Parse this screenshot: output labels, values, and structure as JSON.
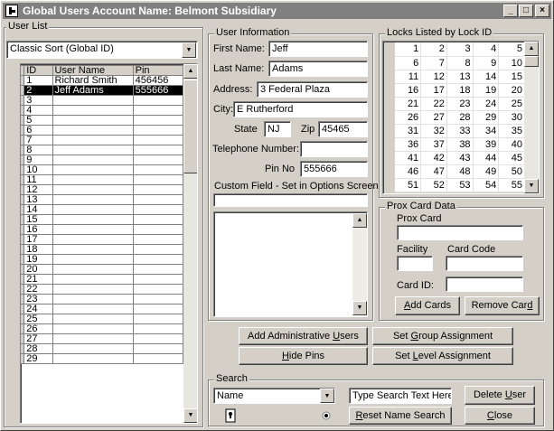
{
  "window": {
    "title": "Global Users Account Name: Belmont Subsidiary",
    "min_label": "_",
    "max_label": "□",
    "close_label": "×"
  },
  "user_list": {
    "group_title": "User List",
    "sort_value": "Classic Sort (Global ID)",
    "columns": [
      "ID",
      "User Name",
      "Pin"
    ],
    "rows": [
      {
        "id": "1",
        "name": "Richard Smith",
        "pin": "456456",
        "selected": false
      },
      {
        "id": "2",
        "name": "Jeff Adams",
        "pin": "555666",
        "selected": true
      },
      {
        "id": "3",
        "name": "",
        "pin": ""
      },
      {
        "id": "4",
        "name": "",
        "pin": ""
      },
      {
        "id": "5",
        "name": "",
        "pin": ""
      },
      {
        "id": "6",
        "name": "",
        "pin": ""
      },
      {
        "id": "7",
        "name": "",
        "pin": ""
      },
      {
        "id": "8",
        "name": "",
        "pin": ""
      },
      {
        "id": "9",
        "name": "",
        "pin": ""
      },
      {
        "id": "10",
        "name": "",
        "pin": ""
      },
      {
        "id": "11",
        "name": "",
        "pin": ""
      },
      {
        "id": "12",
        "name": "",
        "pin": ""
      },
      {
        "id": "13",
        "name": "",
        "pin": ""
      },
      {
        "id": "14",
        "name": "",
        "pin": ""
      },
      {
        "id": "15",
        "name": "",
        "pin": ""
      },
      {
        "id": "16",
        "name": "",
        "pin": ""
      },
      {
        "id": "17",
        "name": "",
        "pin": ""
      },
      {
        "id": "18",
        "name": "",
        "pin": ""
      },
      {
        "id": "19",
        "name": "",
        "pin": ""
      },
      {
        "id": "20",
        "name": "",
        "pin": ""
      },
      {
        "id": "21",
        "name": "",
        "pin": ""
      },
      {
        "id": "22",
        "name": "",
        "pin": ""
      },
      {
        "id": "23",
        "name": "",
        "pin": ""
      },
      {
        "id": "24",
        "name": "",
        "pin": ""
      },
      {
        "id": "25",
        "name": "",
        "pin": ""
      },
      {
        "id": "26",
        "name": "",
        "pin": ""
      },
      {
        "id": "27",
        "name": "",
        "pin": ""
      },
      {
        "id": "28",
        "name": "",
        "pin": ""
      },
      {
        "id": "29",
        "name": "",
        "pin": ""
      }
    ]
  },
  "user_info": {
    "group_title": "User Information",
    "first_name_label": "First Name:",
    "first_name": "Jeff",
    "last_name_label": "Last Name:",
    "last_name": "Adams",
    "address_label": "Address:",
    "address": "3 Federal Plaza",
    "city_label": "City:",
    "city": "E Rutherford",
    "state_label": "State",
    "state": "NJ",
    "zip_label": "Zip",
    "zip": "45465",
    "phone_label": "Telephone Number:",
    "phone": "",
    "pin_label": "Pin No",
    "pin": "555666",
    "custom_label": "Custom Field - Set in Options Screen",
    "custom_value": "",
    "notes": ""
  },
  "locks": {
    "group_title": "Locks Listed by Lock ID",
    "rows": [
      [
        "1",
        "2",
        "3",
        "4",
        "5"
      ],
      [
        "6",
        "7",
        "8",
        "9",
        "10"
      ],
      [
        "11",
        "12",
        "13",
        "14",
        "15"
      ],
      [
        "16",
        "17",
        "18",
        "19",
        "20"
      ],
      [
        "21",
        "22",
        "23",
        "24",
        "25"
      ],
      [
        "26",
        "27",
        "28",
        "29",
        "30"
      ],
      [
        "31",
        "32",
        "33",
        "34",
        "35"
      ],
      [
        "36",
        "37",
        "38",
        "39",
        "40"
      ],
      [
        "41",
        "42",
        "43",
        "44",
        "45"
      ],
      [
        "46",
        "47",
        "48",
        "49",
        "50"
      ],
      [
        "51",
        "52",
        "53",
        "54",
        "55"
      ]
    ]
  },
  "prox": {
    "group_title": "Prox Card Data",
    "prox_card_label": "Prox Card",
    "prox_card": "",
    "facility_label": "Facility",
    "facility": "",
    "card_code_label": "Card Code",
    "card_code": "",
    "card_id_label": "Card ID:",
    "card_id": "",
    "add_cards_pre": "",
    "add_cards_u": "A",
    "add_cards_post": "dd Cards",
    "remove_card_pre": "Remove Car",
    "remove_card_u": "d",
    "remove_card_post": ""
  },
  "actions": {
    "add_admin_pre": "Add Administrative ",
    "add_admin_u": "U",
    "add_admin_post": "sers",
    "hide_pins_pre": "",
    "hide_pins_u": "H",
    "hide_pins_post": "ide Pins",
    "set_group_pre": "Set ",
    "set_group_u": "G",
    "set_group_post": "roup Assignment",
    "set_level_pre": "Set ",
    "set_level_u": "L",
    "set_level_post": "evel Assignment"
  },
  "search": {
    "group_title": "Search",
    "field_value": "Name",
    "search_text": "Type Search Text Here",
    "reset_pre": "",
    "reset_u": "R",
    "reset_post": "eset Name Search",
    "delete_pre": "Delete ",
    "delete_u": "U",
    "delete_post": "ser",
    "close_pre": "",
    "close_u": "C",
    "close_post": "lose"
  }
}
